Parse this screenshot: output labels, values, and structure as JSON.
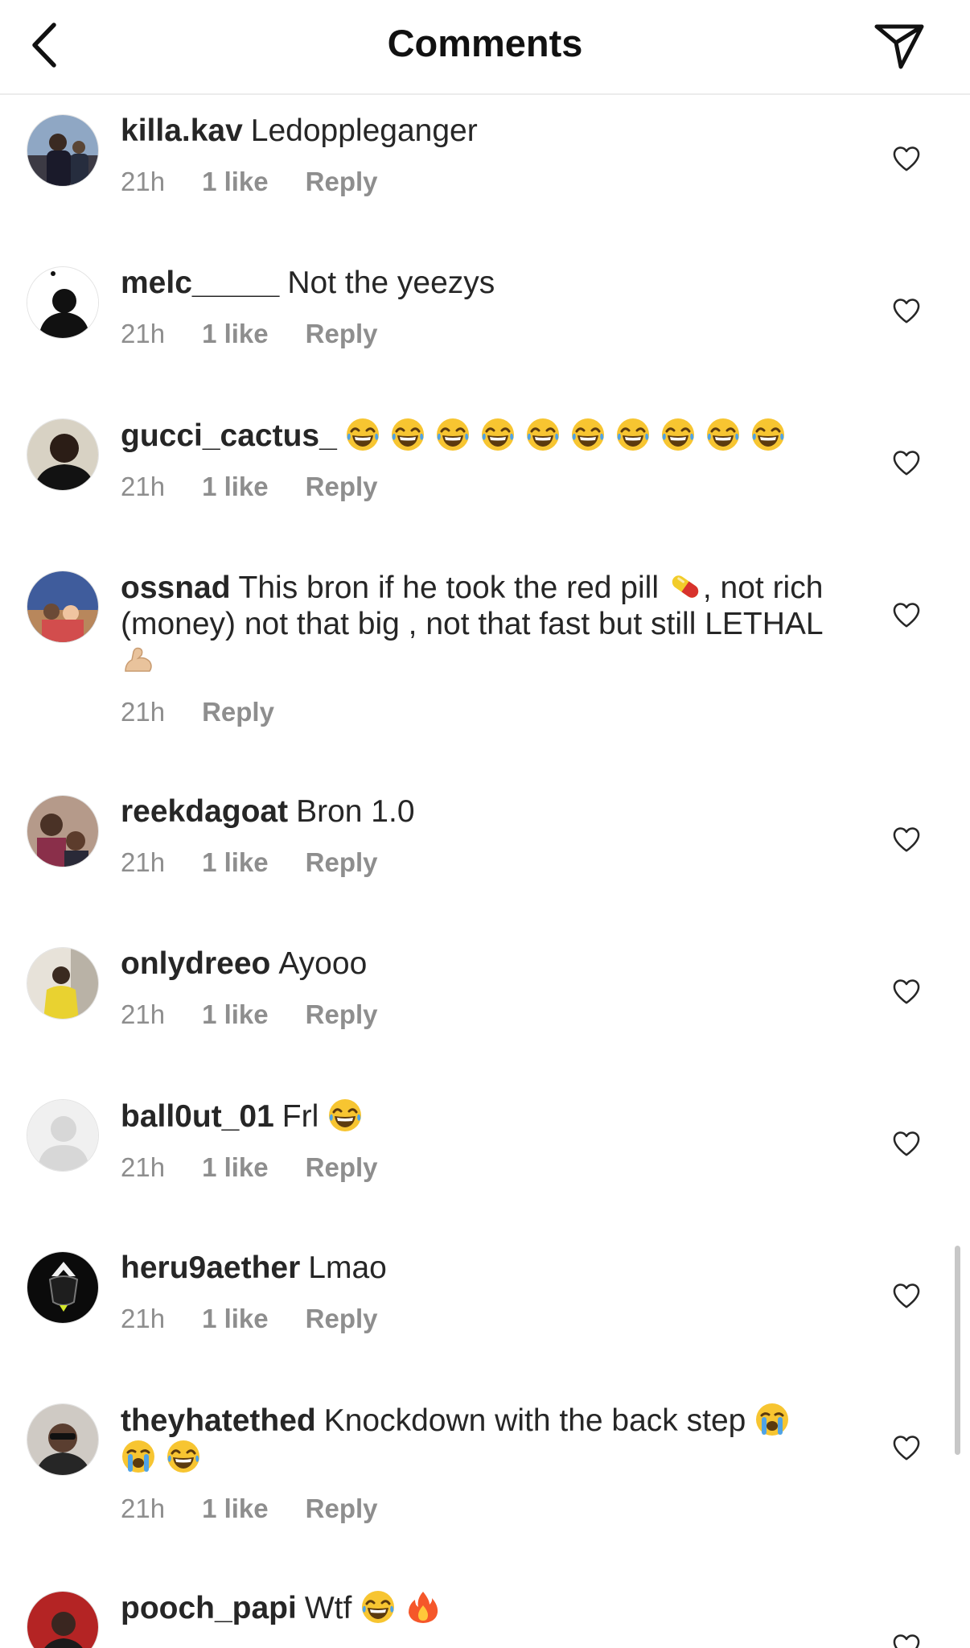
{
  "header": {
    "title": "Comments"
  },
  "comments": [
    {
      "username": "killa.kav",
      "text": "Ledoppleganger",
      "time": "21h",
      "likes": "1 like",
      "reply": "Reply"
    },
    {
      "username": "melc_____",
      "text": "Not the yeezys",
      "time": "21h",
      "likes": "1 like",
      "reply": "Reply"
    },
    {
      "username": "gucci_cactus_",
      "text": "",
      "time": "21h",
      "likes": "1 like",
      "reply": "Reply"
    },
    {
      "username": "ossnad",
      "text": "This bron if he took the red pill",
      "text_after": ", not rich (money) not that big , not that fast but still LETHAL",
      "time": "21h",
      "reply": "Reply"
    },
    {
      "username": "reekdagoat",
      "text": "Bron 1.0",
      "time": "21h",
      "likes": "1 like",
      "reply": "Reply"
    },
    {
      "username": "onlydreeo",
      "text": "Ayooo",
      "time": "21h",
      "likes": "1 like",
      "reply": "Reply"
    },
    {
      "username": "ball0ut_01",
      "text": "Frl",
      "time": "21h",
      "likes": "1 like",
      "reply": "Reply"
    },
    {
      "username": "heru9aether",
      "text": "Lmao",
      "time": "21h",
      "likes": "1 like",
      "reply": "Reply"
    },
    {
      "username": "theyhatethed",
      "text": "Knockdown with the back step",
      "time": "21h",
      "likes": "1 like",
      "reply": "Reply"
    },
    {
      "username": "pooch_papi",
      "text": "Wtf",
      "time": "",
      "likes": "",
      "reply": ""
    }
  ],
  "icons": {
    "back": "chevron-left-icon",
    "share": "paper-plane-icon",
    "like": "heart-outline-icon",
    "emoji_laugh": "face-with-tears-of-joy",
    "emoji_cry": "loudly-crying-face",
    "emoji_pill": "pill",
    "emoji_muscle": "flexed-biceps",
    "emoji_fire": "fire"
  },
  "colors": {
    "text": "#262626",
    "meta": "#8e8e8e",
    "divider": "#ececec"
  }
}
